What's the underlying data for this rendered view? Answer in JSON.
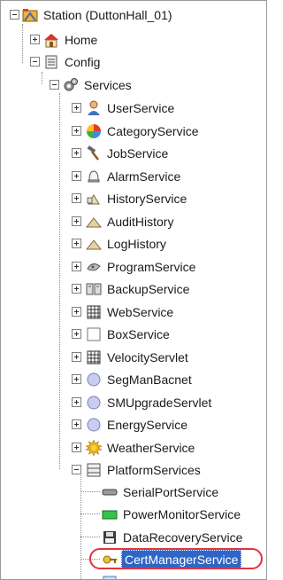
{
  "tree": {
    "station": {
      "label": "Station (DuttonHall_01)",
      "icon": "station-icon"
    },
    "home": {
      "label": "Home",
      "icon": "home-icon"
    },
    "config": {
      "label": "Config",
      "icon": "config-icon"
    },
    "services": {
      "label": "Services",
      "icon": "services-gear-icon"
    },
    "service_items": [
      {
        "label": "UserService",
        "icon": "user-icon"
      },
      {
        "label": "CategoryService",
        "icon": "category-icon"
      },
      {
        "label": "JobService",
        "icon": "hammer-icon"
      },
      {
        "label": "AlarmService",
        "icon": "bell-icon"
      },
      {
        "label": "HistoryService",
        "icon": "history-icon"
      },
      {
        "label": "AuditHistory",
        "icon": "triangle-icon"
      },
      {
        "label": "LogHistory",
        "icon": "triangle-icon"
      },
      {
        "label": "ProgramService",
        "icon": "program-icon"
      },
      {
        "label": "BackupService",
        "icon": "backup-icon"
      },
      {
        "label": "WebService",
        "icon": "web-icon"
      },
      {
        "label": "BoxService",
        "icon": "box-icon"
      },
      {
        "label": "VelocityServlet",
        "icon": "web-icon"
      },
      {
        "label": "SegManBacnet",
        "icon": "circle-icon"
      },
      {
        "label": "SMUpgradeServlet",
        "icon": "circle-icon"
      },
      {
        "label": "EnergyService",
        "icon": "circle-icon"
      },
      {
        "label": "WeatherService",
        "icon": "sun-icon"
      },
      {
        "label": "PlatformServices",
        "icon": "platform-icon"
      }
    ],
    "platform_children": [
      {
        "label": "SerialPortService",
        "icon": "serial-port-icon"
      },
      {
        "label": "PowerMonitorService",
        "icon": "battery-icon"
      },
      {
        "label": "DataRecoveryService",
        "icon": "floppy-icon"
      },
      {
        "label": "CertManagerService",
        "icon": "cert-key-icon",
        "selected": true
      }
    ]
  },
  "colors": {
    "selection": "#2f66c6",
    "annotation_ring": "#e3333f"
  }
}
